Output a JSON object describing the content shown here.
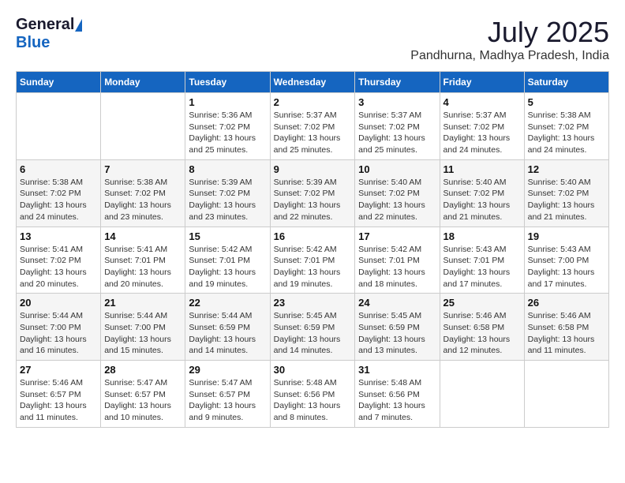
{
  "header": {
    "logo_general": "General",
    "logo_blue": "Blue",
    "month_year": "July 2025",
    "location": "Pandhurna, Madhya Pradesh, India"
  },
  "weekdays": [
    "Sunday",
    "Monday",
    "Tuesday",
    "Wednesday",
    "Thursday",
    "Friday",
    "Saturday"
  ],
  "weeks": [
    [
      {
        "day": "",
        "info": ""
      },
      {
        "day": "",
        "info": ""
      },
      {
        "day": "1",
        "info": "Sunrise: 5:36 AM\nSunset: 7:02 PM\nDaylight: 13 hours and 25 minutes."
      },
      {
        "day": "2",
        "info": "Sunrise: 5:37 AM\nSunset: 7:02 PM\nDaylight: 13 hours and 25 minutes."
      },
      {
        "day": "3",
        "info": "Sunrise: 5:37 AM\nSunset: 7:02 PM\nDaylight: 13 hours and 25 minutes."
      },
      {
        "day": "4",
        "info": "Sunrise: 5:37 AM\nSunset: 7:02 PM\nDaylight: 13 hours and 24 minutes."
      },
      {
        "day": "5",
        "info": "Sunrise: 5:38 AM\nSunset: 7:02 PM\nDaylight: 13 hours and 24 minutes."
      }
    ],
    [
      {
        "day": "6",
        "info": "Sunrise: 5:38 AM\nSunset: 7:02 PM\nDaylight: 13 hours and 24 minutes."
      },
      {
        "day": "7",
        "info": "Sunrise: 5:38 AM\nSunset: 7:02 PM\nDaylight: 13 hours and 23 minutes."
      },
      {
        "day": "8",
        "info": "Sunrise: 5:39 AM\nSunset: 7:02 PM\nDaylight: 13 hours and 23 minutes."
      },
      {
        "day": "9",
        "info": "Sunrise: 5:39 AM\nSunset: 7:02 PM\nDaylight: 13 hours and 22 minutes."
      },
      {
        "day": "10",
        "info": "Sunrise: 5:40 AM\nSunset: 7:02 PM\nDaylight: 13 hours and 22 minutes."
      },
      {
        "day": "11",
        "info": "Sunrise: 5:40 AM\nSunset: 7:02 PM\nDaylight: 13 hours and 21 minutes."
      },
      {
        "day": "12",
        "info": "Sunrise: 5:40 AM\nSunset: 7:02 PM\nDaylight: 13 hours and 21 minutes."
      }
    ],
    [
      {
        "day": "13",
        "info": "Sunrise: 5:41 AM\nSunset: 7:02 PM\nDaylight: 13 hours and 20 minutes."
      },
      {
        "day": "14",
        "info": "Sunrise: 5:41 AM\nSunset: 7:01 PM\nDaylight: 13 hours and 20 minutes."
      },
      {
        "day": "15",
        "info": "Sunrise: 5:42 AM\nSunset: 7:01 PM\nDaylight: 13 hours and 19 minutes."
      },
      {
        "day": "16",
        "info": "Sunrise: 5:42 AM\nSunset: 7:01 PM\nDaylight: 13 hours and 19 minutes."
      },
      {
        "day": "17",
        "info": "Sunrise: 5:42 AM\nSunset: 7:01 PM\nDaylight: 13 hours and 18 minutes."
      },
      {
        "day": "18",
        "info": "Sunrise: 5:43 AM\nSunset: 7:01 PM\nDaylight: 13 hours and 17 minutes."
      },
      {
        "day": "19",
        "info": "Sunrise: 5:43 AM\nSunset: 7:00 PM\nDaylight: 13 hours and 17 minutes."
      }
    ],
    [
      {
        "day": "20",
        "info": "Sunrise: 5:44 AM\nSunset: 7:00 PM\nDaylight: 13 hours and 16 minutes."
      },
      {
        "day": "21",
        "info": "Sunrise: 5:44 AM\nSunset: 7:00 PM\nDaylight: 13 hours and 15 minutes."
      },
      {
        "day": "22",
        "info": "Sunrise: 5:44 AM\nSunset: 6:59 PM\nDaylight: 13 hours and 14 minutes."
      },
      {
        "day": "23",
        "info": "Sunrise: 5:45 AM\nSunset: 6:59 PM\nDaylight: 13 hours and 14 minutes."
      },
      {
        "day": "24",
        "info": "Sunrise: 5:45 AM\nSunset: 6:59 PM\nDaylight: 13 hours and 13 minutes."
      },
      {
        "day": "25",
        "info": "Sunrise: 5:46 AM\nSunset: 6:58 PM\nDaylight: 13 hours and 12 minutes."
      },
      {
        "day": "26",
        "info": "Sunrise: 5:46 AM\nSunset: 6:58 PM\nDaylight: 13 hours and 11 minutes."
      }
    ],
    [
      {
        "day": "27",
        "info": "Sunrise: 5:46 AM\nSunset: 6:57 PM\nDaylight: 13 hours and 11 minutes."
      },
      {
        "day": "28",
        "info": "Sunrise: 5:47 AM\nSunset: 6:57 PM\nDaylight: 13 hours and 10 minutes."
      },
      {
        "day": "29",
        "info": "Sunrise: 5:47 AM\nSunset: 6:57 PM\nDaylight: 13 hours and 9 minutes."
      },
      {
        "day": "30",
        "info": "Sunrise: 5:48 AM\nSunset: 6:56 PM\nDaylight: 13 hours and 8 minutes."
      },
      {
        "day": "31",
        "info": "Sunrise: 5:48 AM\nSunset: 6:56 PM\nDaylight: 13 hours and 7 minutes."
      },
      {
        "day": "",
        "info": ""
      },
      {
        "day": "",
        "info": ""
      }
    ]
  ]
}
